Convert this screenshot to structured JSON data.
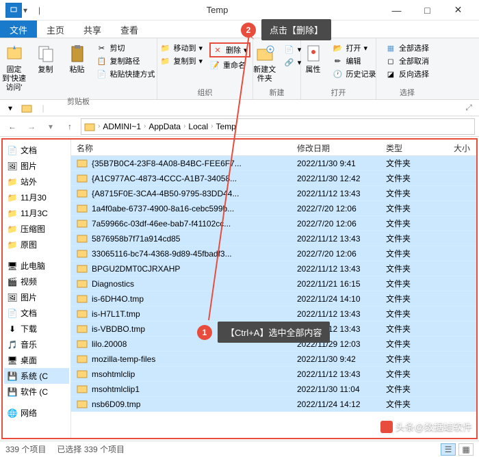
{
  "window": {
    "title": "Temp"
  },
  "tabs": {
    "file": "文件",
    "home": "主页",
    "share": "共享",
    "view": "查看"
  },
  "ribbon": {
    "pin": "固定到'快速访问'",
    "copy": "复制",
    "paste": "粘贴",
    "cut": "剪切",
    "copypath": "复制路径",
    "pasteshortcut": "粘贴快捷方式",
    "moveto": "移动到",
    "copyto": "复制到",
    "delete": "删除",
    "rename": "重命名",
    "newfolder": "新建文件夹",
    "properties": "属性",
    "open": "打开",
    "edit": "编辑",
    "history": "历史记录",
    "selectall": "全部选择",
    "selectnone": "全部取消",
    "invertsel": "反向选择",
    "g_clipboard": "剪贴板",
    "g_organize": "组织",
    "g_new": "新建",
    "g_open": "打开",
    "g_select": "选择"
  },
  "breadcrumb": [
    "ADMINI~1",
    "AppData",
    "Local",
    "Temp"
  ],
  "sidebar": {
    "items": [
      {
        "label": "文档",
        "icon": "document"
      },
      {
        "label": "图片",
        "icon": "picture"
      },
      {
        "label": "站外",
        "icon": "folder"
      },
      {
        "label": "11月30",
        "icon": "folder"
      },
      {
        "label": "11月3C",
        "icon": "folder"
      },
      {
        "label": "压缩图",
        "icon": "folder"
      },
      {
        "label": "原图",
        "icon": "folder"
      },
      {
        "label": "此电脑",
        "icon": "computer"
      },
      {
        "label": "视频",
        "icon": "video"
      },
      {
        "label": "图片",
        "icon": "picture"
      },
      {
        "label": "文档",
        "icon": "document"
      },
      {
        "label": "下载",
        "icon": "download"
      },
      {
        "label": "音乐",
        "icon": "music"
      },
      {
        "label": "桌面",
        "icon": "desktop"
      },
      {
        "label": "系统 (C",
        "icon": "drive"
      },
      {
        "label": "软件 (C",
        "icon": "drive"
      },
      {
        "label": "网络",
        "icon": "network"
      }
    ]
  },
  "columns": {
    "name": "名称",
    "date": "修改日期",
    "type": "类型",
    "size": "大小"
  },
  "files": [
    {
      "name": "{35B7B0C4-23F8-4A08-B4BC-FEE6F7...",
      "date": "2022/11/30 9:41",
      "type": "文件夹"
    },
    {
      "name": "{A1C977AC-4873-4CCC-A1B7-34058...",
      "date": "2022/11/30 12:42",
      "type": "文件夹"
    },
    {
      "name": "{A8715F0E-3CA4-4B50-9795-83DD44...",
      "date": "2022/11/12 13:43",
      "type": "文件夹"
    },
    {
      "name": "1a4f0abe-6737-4900-8a16-cebc599b...",
      "date": "2022/7/20 12:06",
      "type": "文件夹"
    },
    {
      "name": "7a59966c-03df-46ee-bab7-f41102cc...",
      "date": "2022/7/20 12:06",
      "type": "文件夹"
    },
    {
      "name": "5876958b7f71a914cd85",
      "date": "2022/11/12 13:43",
      "type": "文件夹"
    },
    {
      "name": "33065116-bc74-4368-9d89-45fbadf3...",
      "date": "2022/7/20 12:06",
      "type": "文件夹"
    },
    {
      "name": "BPGU2DMT0CJRXAHP",
      "date": "2022/11/12 13:43",
      "type": "文件夹"
    },
    {
      "name": "Diagnostics",
      "date": "2022/11/21 16:15",
      "type": "文件夹"
    },
    {
      "name": "is-6DH4O.tmp",
      "date": "2022/11/24 14:10",
      "type": "文件夹"
    },
    {
      "name": "is-H7L1T.tmp",
      "date": "2022/11/12 13:43",
      "type": "文件夹"
    },
    {
      "name": "is-VBDBO.tmp",
      "date": "2022/11/12 13:43",
      "type": "文件夹"
    },
    {
      "name": "lilo.20008",
      "date": "2022/11/29 12:03",
      "type": "文件夹"
    },
    {
      "name": "mozilla-temp-files",
      "date": "2022/11/30 9:42",
      "type": "文件夹"
    },
    {
      "name": "msohtmlclip",
      "date": "2022/11/12 13:43",
      "type": "文件夹"
    },
    {
      "name": "msohtmlclip1",
      "date": "2022/11/30 11:04",
      "type": "文件夹"
    },
    {
      "name": "nsb6D09.tmp",
      "date": "2022/11/24 14:12",
      "type": "文件夹"
    }
  ],
  "status": {
    "total": "339 个项目",
    "selected": "已选择 339 个项目"
  },
  "callouts": {
    "step1": "【Ctrl+A】选中全部内容",
    "step2": "点击【删除】"
  },
  "watermark": "头条@数据蛙软件"
}
